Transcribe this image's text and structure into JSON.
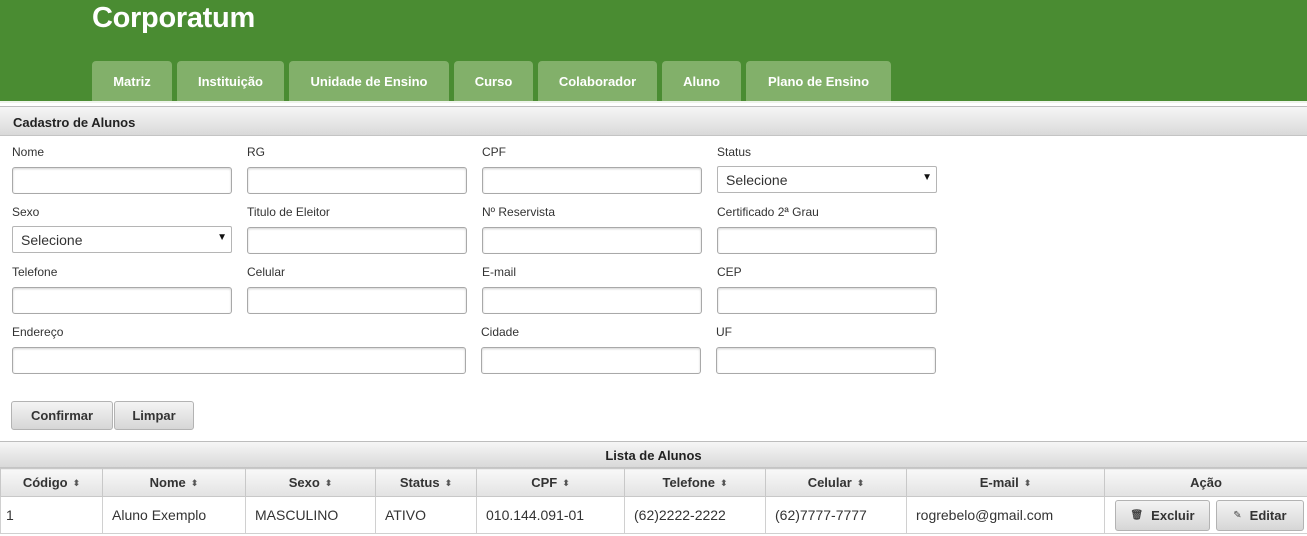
{
  "app": {
    "title": "Corporatum"
  },
  "nav": {
    "tabs": [
      {
        "label": "Matriz"
      },
      {
        "label": "Instituição"
      },
      {
        "label": "Unidade de Ensino"
      },
      {
        "label": "Curso"
      },
      {
        "label": "Colaborador"
      },
      {
        "label": "Aluno"
      },
      {
        "label": "Plano de Ensino"
      }
    ]
  },
  "form": {
    "title": "Cadastro de Alunos",
    "nome": {
      "label": "Nome",
      "value": ""
    },
    "rg": {
      "label": "RG",
      "value": ""
    },
    "cpf": {
      "label": "CPF",
      "value": ""
    },
    "status": {
      "label": "Status",
      "selected": "Selecione"
    },
    "sexo": {
      "label": "Sexo",
      "selected": "Selecione"
    },
    "titulo": {
      "label": "Titulo de Eleitor",
      "value": ""
    },
    "reservista": {
      "label": "Nº Reservista",
      "value": ""
    },
    "certificado": {
      "label": "Certificado 2ª Grau",
      "value": ""
    },
    "telefone": {
      "label": "Telefone",
      "value": ""
    },
    "celular": {
      "label": "Celular",
      "value": ""
    },
    "email": {
      "label": "E-mail",
      "value": ""
    },
    "cep": {
      "label": "CEP",
      "value": ""
    },
    "endereco": {
      "label": "Endereço",
      "value": ""
    },
    "cidade": {
      "label": "Cidade",
      "value": ""
    },
    "uf": {
      "label": "UF",
      "value": ""
    },
    "confirm_label": "Confirmar",
    "clear_label": "Limpar"
  },
  "list": {
    "title": "Lista de Alunos",
    "columns": {
      "codigo": "Código",
      "nome": "Nome",
      "sexo": "Sexo",
      "status": "Status",
      "cpf": "CPF",
      "telefone": "Telefone",
      "celular": "Celular",
      "email": "E-mail",
      "acao": "Ação"
    },
    "rows": [
      {
        "codigo": "1",
        "nome": "Aluno Exemplo",
        "sexo": "MASCULINO",
        "status": "ATIVO",
        "cpf": "010.144.091-01",
        "telefone": "(62)2222-2222",
        "celular": "(62)7777-7777",
        "email": "rogrebelo@gmail.com",
        "delete_label": "Excluir",
        "edit_label": "Editar"
      }
    ]
  },
  "icons": {
    "sort": "sort-both-icon",
    "caret": "caret-down-icon",
    "trash": "trash-icon",
    "pencil": "pencil-icon"
  },
  "colors": {
    "header_bg": "#4a8c32",
    "tab_bg": "#82b06a",
    "text": "#333333"
  }
}
